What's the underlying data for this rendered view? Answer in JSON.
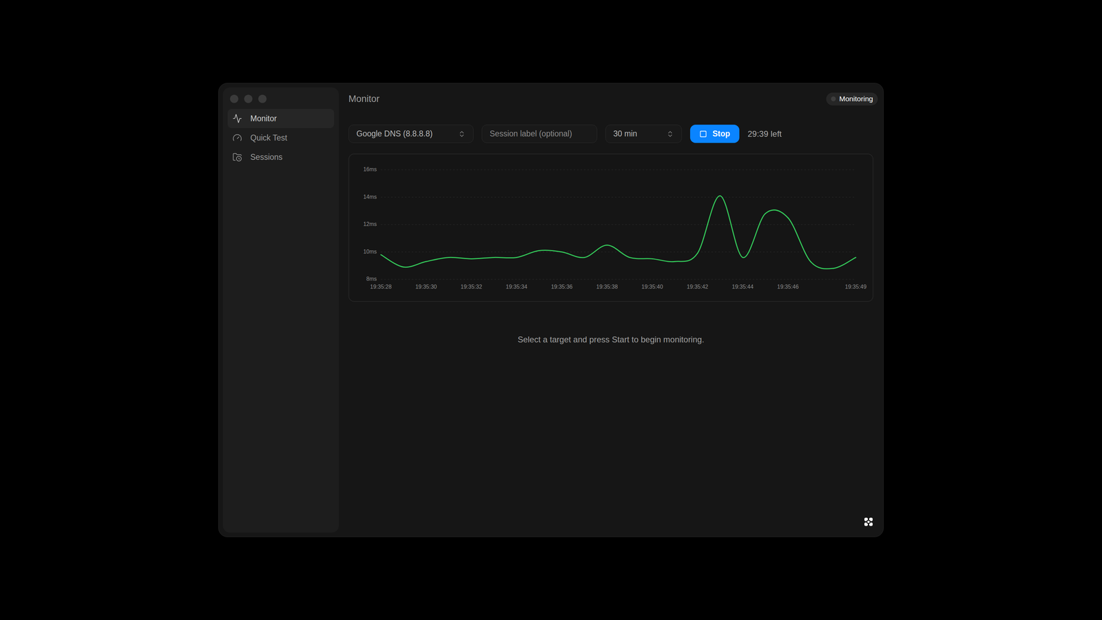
{
  "window": {
    "title": "Monitor"
  },
  "status_badge": {
    "label": "Monitoring"
  },
  "sidebar": {
    "items": [
      {
        "label": "Monitor",
        "selected": true
      },
      {
        "label": "Quick Test",
        "selected": false
      },
      {
        "label": "Sessions",
        "selected": false
      }
    ]
  },
  "controls": {
    "target": "Google DNS (8.8.8.8)",
    "session_label_placeholder": "Session label (optional)",
    "duration": "30 min",
    "action_button": "Stop",
    "time_left": "29:39 left"
  },
  "chart": {
    "y_ticks": [
      "16ms",
      "14ms",
      "12ms",
      "10ms",
      "8ms"
    ],
    "x_ticks": [
      "19:35:28",
      "19:35:30",
      "19:35:32",
      "19:35:34",
      "19:35:36",
      "19:35:38",
      "19:35:40",
      "19:35:42",
      "19:35:44",
      "19:35:46",
      "19:35:49"
    ],
    "series": [
      {
        "values": [
          9.8,
          8.9,
          9.3,
          9.6,
          9.5,
          9.6,
          9.6,
          10.1,
          10.0,
          9.6,
          10.5,
          9.6,
          9.5,
          9.3,
          9.9,
          14.1,
          9.6,
          12.8,
          12.5,
          9.3,
          8.8,
          9.6
        ]
      }
    ]
  },
  "empty_message": "Select a target and press Start to begin monitoring."
}
